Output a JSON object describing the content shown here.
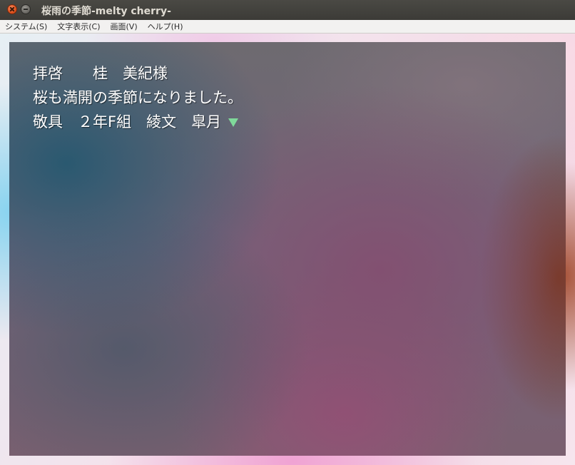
{
  "window": {
    "title": "桜雨の季節-melty cherry-"
  },
  "menubar": {
    "items": [
      {
        "label": "システム(S)"
      },
      {
        "label": "文字表示(C)"
      },
      {
        "label": "画面(V)"
      },
      {
        "label": "ヘルプ(H)"
      }
    ]
  },
  "message": {
    "lines": [
      "拝啓　　桂　美紀様",
      "桜も満開の季節になりました。",
      "敬具　２年F組　綾文　皐月"
    ],
    "next_indicator": "next-arrow-icon"
  },
  "colors": {
    "indicator": "#7fd99a",
    "text": "#ffffff"
  }
}
